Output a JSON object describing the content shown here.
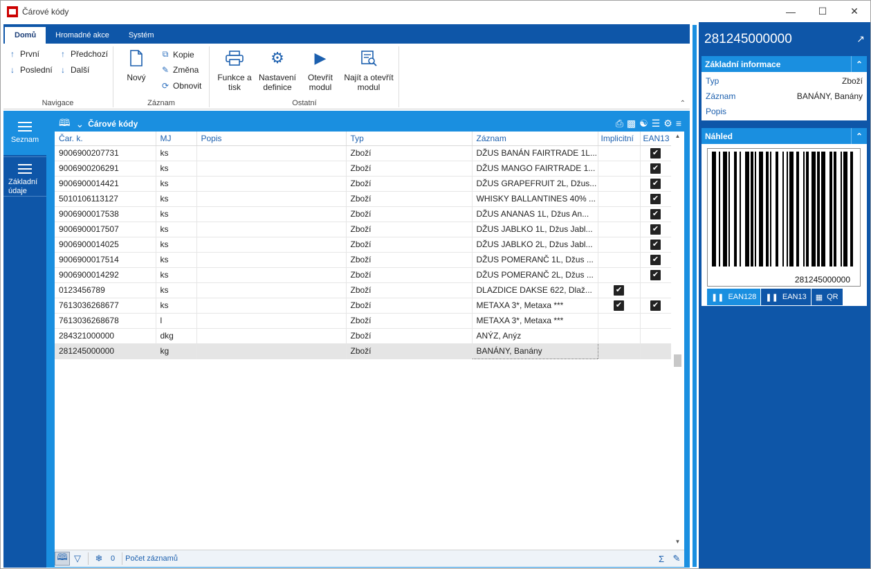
{
  "window": {
    "title": "Čárové kódy"
  },
  "ribbon": {
    "tabs": [
      "Domů",
      "Hromadné akce",
      "Systém"
    ],
    "groups": {
      "navigace": {
        "label": "Navigace",
        "first": "První",
        "last": "Poslední",
        "prev": "Předchozí",
        "next": "Další"
      },
      "zaznam": {
        "label": "Záznam",
        "new": "Nový",
        "copy": "Kopie",
        "change": "Změna",
        "refresh": "Obnovit"
      },
      "ostatni": {
        "label": "Ostatní",
        "functions_1": "Funkce a",
        "functions_2": "tisk",
        "settings_1": "Nastavení",
        "settings_2": "definice",
        "open_1": "Otevřít",
        "open_2": "modul",
        "find_1": "Najít a otevřít",
        "find_2": "modul"
      }
    }
  },
  "sidebar": {
    "items": [
      {
        "label": "Seznam"
      },
      {
        "label_1": "Základní",
        "label_2": "údaje"
      }
    ]
  },
  "panel": {
    "title": "Čárové kódy"
  },
  "grid": {
    "columns": [
      "Čar. k.",
      "MJ",
      "Popis",
      "Typ",
      "Záznam",
      "Implicitní",
      "EAN13"
    ],
    "rows": [
      {
        "code": "9006900207731",
        "mj": "ks",
        "popis": "",
        "typ": "Zboží",
        "zaznam": "DŽUS BANÁN FAIRTRADE 1L...",
        "impl": false,
        "ean13": true
      },
      {
        "code": "9006900206291",
        "mj": "ks",
        "popis": "",
        "typ": "Zboží",
        "zaznam": "DŽUS MANGO FAIRTRADE 1...",
        "impl": false,
        "ean13": true
      },
      {
        "code": "9006900014421",
        "mj": "ks",
        "popis": "",
        "typ": "Zboží",
        "zaznam": "DŽUS GRAPEFRUIT 2L, Džus...",
        "impl": false,
        "ean13": true
      },
      {
        "code": "5010106113127",
        "mj": "ks",
        "popis": "",
        "typ": "Zboží",
        "zaznam": "WHISKY BALLANTINES 40% ...",
        "impl": false,
        "ean13": true
      },
      {
        "code": "9006900017538",
        "mj": "ks",
        "popis": "",
        "typ": "Zboží",
        "zaznam": "DŽUS ANANAS 1L, Džus An...",
        "impl": false,
        "ean13": true
      },
      {
        "code": "9006900017507",
        "mj": "ks",
        "popis": "",
        "typ": "Zboží",
        "zaznam": "DŽUS JABLKO 1L, Džus Jabl...",
        "impl": false,
        "ean13": true
      },
      {
        "code": "9006900014025",
        "mj": "ks",
        "popis": "",
        "typ": "Zboží",
        "zaznam": "DŽUS JABLKO 2L, Džus Jabl...",
        "impl": false,
        "ean13": true
      },
      {
        "code": "9006900017514",
        "mj": "ks",
        "popis": "",
        "typ": "Zboží",
        "zaznam": "DŽUS POMERANČ 1L, Džus ...",
        "impl": false,
        "ean13": true
      },
      {
        "code": "9006900014292",
        "mj": "ks",
        "popis": "",
        "typ": "Zboží",
        "zaznam": "DŽUS POMERANČ 2L, Džus ...",
        "impl": false,
        "ean13": true
      },
      {
        "code": "0123456789",
        "mj": "ks",
        "popis": "",
        "typ": "Zboží",
        "zaznam": "DLAZDICE DAKSE 622, Dlaž...",
        "impl": true,
        "ean13": false
      },
      {
        "code": "7613036268677",
        "mj": "ks",
        "popis": "",
        "typ": "Zboží",
        "zaznam": "METAXA 3*, Metaxa ***",
        "impl": true,
        "ean13": true
      },
      {
        "code": "7613036268678",
        "mj": "l",
        "popis": "",
        "typ": "Zboží",
        "zaznam": "METAXA 3*, Metaxa ***",
        "impl": false,
        "ean13": false
      },
      {
        "code": "284321000000",
        "mj": "dkg",
        "popis": "",
        "typ": "Zboží",
        "zaznam": "ANÝZ, Anýz",
        "impl": false,
        "ean13": false
      },
      {
        "code": "281245000000",
        "mj": "kg",
        "popis": "",
        "typ": "Zboží",
        "zaznam": "BANÁNY, Banány",
        "impl": false,
        "ean13": false,
        "selected": true
      }
    ]
  },
  "statusbar": {
    "filter_count": "0",
    "record_count_label": "Počet záznamů"
  },
  "detail": {
    "title": "281245000000",
    "basic_info": {
      "header": "Základní informace",
      "typ_label": "Typ",
      "typ_value": "Zboží",
      "zaznam_label": "Záznam",
      "zaznam_value": "BANÁNY, Banány",
      "popis_label": "Popis",
      "popis_value": ""
    },
    "preview": {
      "header": "Náhled",
      "barcode_text": "281245000000",
      "tabs": [
        "EAN128",
        "EAN13",
        "QR"
      ],
      "active_tab": "EAN128"
    }
  },
  "colors": {
    "dark_blue": "#0e56a8",
    "light_blue": "#1a8fe0"
  }
}
